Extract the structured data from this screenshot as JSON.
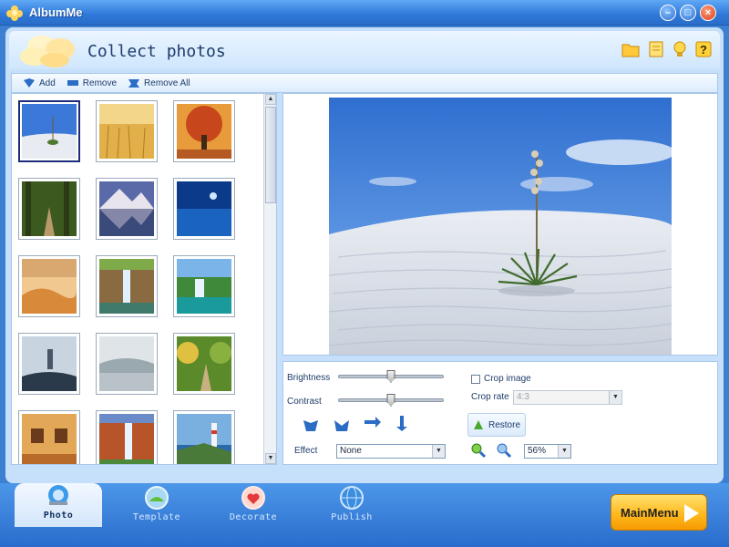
{
  "window": {
    "title": "AlbumMe"
  },
  "header": {
    "title": "Collect photos"
  },
  "toolbar": {
    "add": "Add",
    "remove": "Remove",
    "remove_all": "Remove All"
  },
  "thumbnails": [
    "white-sands-yucca",
    "golden-grass-field",
    "autumn-tree",
    "forest-path",
    "mountain-lake-reflection",
    "blue-ocean-night",
    "desert-dunes",
    "canyon-waterfall",
    "tropical-waterfall",
    "foggy-castle",
    "misty-valley",
    "woodland-road",
    "old-house-windows",
    "red-cliff-waterfall",
    "coastal-lighthouse"
  ],
  "controls": {
    "brightness_label": "Brightness",
    "contrast_label": "Contrast",
    "brightness_level": 0.5,
    "contrast_level": 0.5,
    "effect_label": "Effect",
    "effect_value": "None",
    "crop_image_label": "Crop image",
    "crop_rate_label": "Crop rate",
    "crop_rate_value": "4:3",
    "restore_label": "Restore",
    "zoom_value": "56%"
  },
  "tabs": [
    {
      "label": "Photo",
      "icon": "photo-icon"
    },
    {
      "label": "Template",
      "icon": "template-icon"
    },
    {
      "label": "Decorate",
      "icon": "decorate-icon"
    },
    {
      "label": "Publish",
      "icon": "publish-icon"
    }
  ],
  "main_menu": "MainMenu",
  "colors": {
    "accent": "#2f78d8",
    "panel": "#c6e0fb",
    "main_menu": "#ffba1f"
  }
}
